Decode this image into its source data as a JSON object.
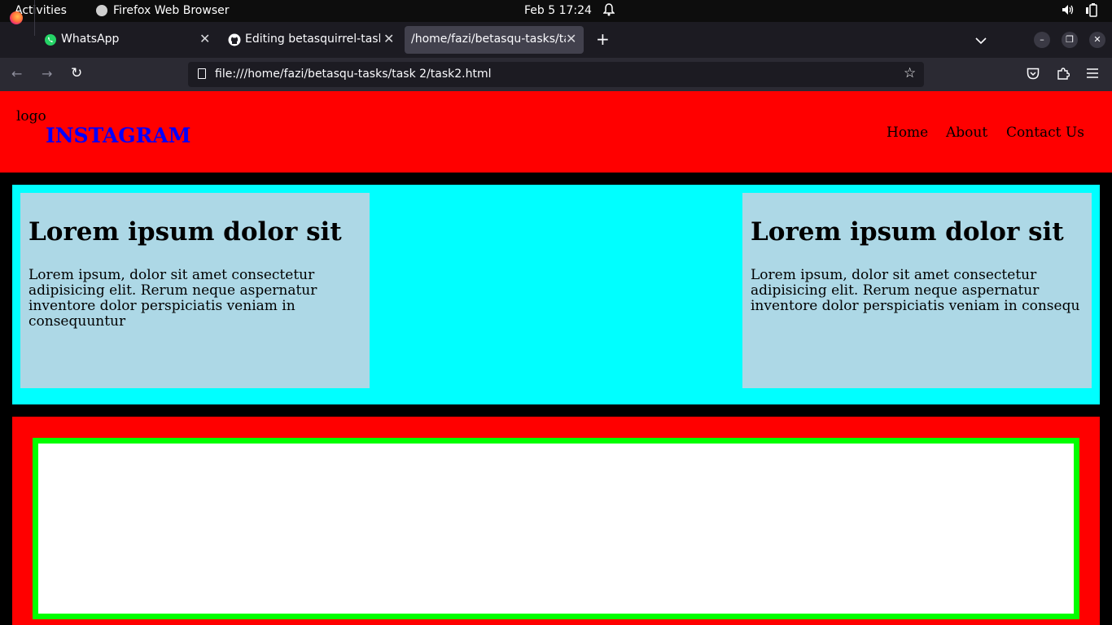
{
  "system_bar": {
    "activities": "Activities",
    "app_name": "Firefox Web Browser",
    "clock": "Feb 5  17:24"
  },
  "browser": {
    "tabs": [
      {
        "label": "WhatsApp",
        "icon": "whatsapp-icon"
      },
      {
        "label": "Editing betasquirrel-task",
        "icon": "github-icon"
      },
      {
        "label": "/home/fazi/betasqu-tasks/ta",
        "active": true
      }
    ],
    "url": "file:///home/fazi/betasqu-tasks/task 2/task2.html"
  },
  "page": {
    "header": {
      "logo": "logo",
      "brand": "INSTAGRAM",
      "nav": [
        "Home",
        "About",
        "Contact Us"
      ]
    },
    "cards": [
      {
        "title": "Lorem ipsum dolor sit",
        "text": "Lorem ipsum, dolor sit amet consectetur adipisicing elit. Rerum neque aspernatur inventore dolor perspiciatis veniam in consequuntur"
      },
      {
        "title": "Lorem ipsum dolor sit",
        "text": "Lorem ipsum, dolor sit amet consectetur adipisicing elit. Rerum neque aspernatur inventore dolor perspiciatis veniam in consequ"
      }
    ]
  },
  "colors": {
    "header_bg": "#ff0000",
    "brand": "#0000ff",
    "cyan_section": "#00ffff",
    "card_bg": "#add8e6",
    "green_border": "#00ff00"
  }
}
